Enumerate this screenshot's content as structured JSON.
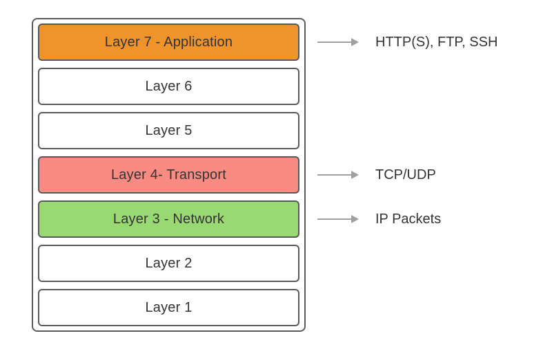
{
  "layers": [
    {
      "label": "Layer 7 - Application",
      "color": "orange",
      "annotation": "HTTP(S), FTP, SSH"
    },
    {
      "label": "Layer 6",
      "color": "white",
      "annotation": null
    },
    {
      "label": "Layer 5",
      "color": "white",
      "annotation": null
    },
    {
      "label": "Layer 4- Transport",
      "color": "red",
      "annotation": "TCP/UDP"
    },
    {
      "label": "Layer 3 - Network",
      "color": "green",
      "annotation": "IP Packets"
    },
    {
      "label": "Layer 2",
      "color": "white",
      "annotation": null
    },
    {
      "label": "Layer 1",
      "color": "white",
      "annotation": null
    }
  ]
}
